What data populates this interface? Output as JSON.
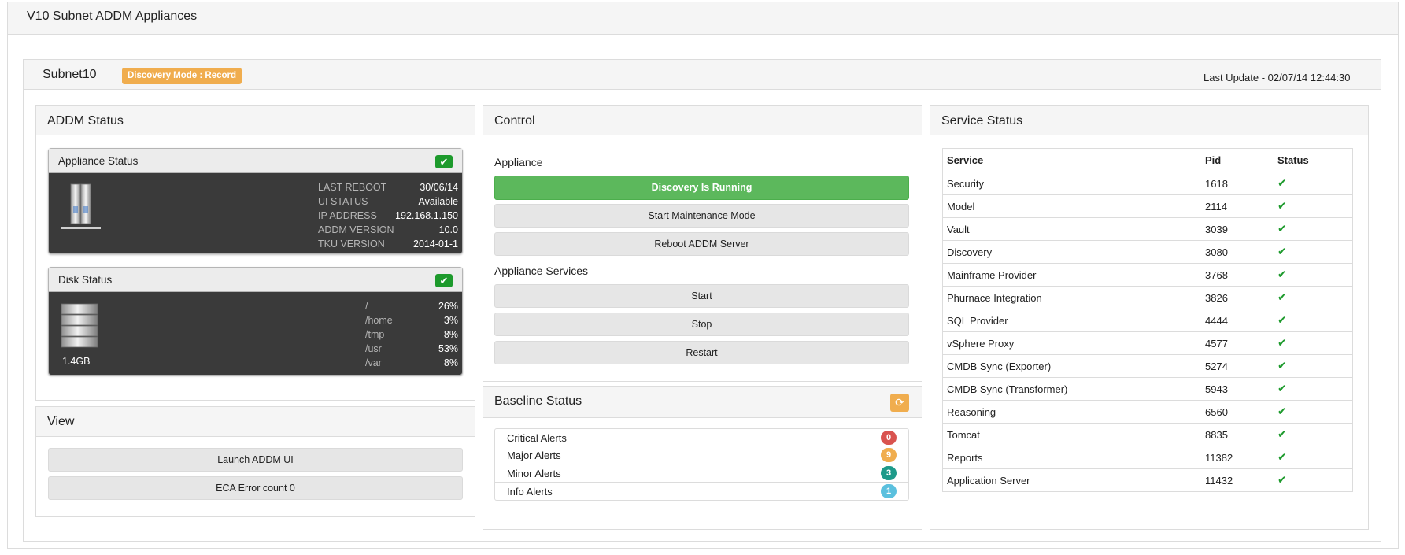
{
  "page": {
    "title": "V10 Subnet ADDM Appliances"
  },
  "subnet": {
    "name": "Subnet10",
    "mode_badge": "Discovery Mode : Record",
    "last_update": "Last Update - 02/07/14 12:44:30"
  },
  "addm_status": {
    "title": "ADDM Status",
    "appliance": {
      "title": "Appliance Status",
      "rows": [
        {
          "label": "LAST REBOOT",
          "value": "30/06/14"
        },
        {
          "label": "UI STATUS",
          "value": "Available"
        },
        {
          "label": "IP ADDRESS",
          "value": "192.168.1.150"
        },
        {
          "label": "ADDM VERSION",
          "value": "10.0"
        },
        {
          "label": "TKU VERSION",
          "value": "2014-01-1"
        }
      ],
      "icon": "server-icon",
      "status_icon": "check-icon"
    },
    "disk": {
      "title": "Disk Status",
      "size": "1.4GB",
      "rows": [
        {
          "label": "/",
          "value": "26%"
        },
        {
          "label": "/home",
          "value": "3%"
        },
        {
          "label": "/tmp",
          "value": "8%"
        },
        {
          "label": "/usr",
          "value": "53%"
        },
        {
          "label": "/var",
          "value": "8%"
        }
      ],
      "icon": "disk-stack-icon",
      "status_icon": "check-icon"
    }
  },
  "view": {
    "title": "View",
    "buttons": [
      "Launch ADDM UI",
      "ECA Error count 0"
    ]
  },
  "control": {
    "title": "Control",
    "appliance_label": "Appliance",
    "appliance_buttons": [
      "Discovery Is Running",
      "Start Maintenance Mode",
      "Reboot ADDM Server"
    ],
    "services_label": "Appliance Services",
    "service_buttons": [
      "Start",
      "Stop",
      "Restart"
    ]
  },
  "baseline": {
    "title": "Baseline Status",
    "refresh_icon": "refresh-icon",
    "alerts": [
      {
        "label": "Critical Alerts",
        "count": "0",
        "color": "#d9534f"
      },
      {
        "label": "Major Alerts",
        "count": "9",
        "color": "#f0ad4e"
      },
      {
        "label": "Minor Alerts",
        "count": "3",
        "color": "#1e9a8a"
      },
      {
        "label": "Info Alerts",
        "count": "1",
        "color": "#5bc0de"
      }
    ]
  },
  "service_status": {
    "title": "Service Status",
    "columns": [
      "Service",
      "Pid",
      "Status"
    ],
    "rows": [
      {
        "service": "Security",
        "pid": "1618",
        "status": "ok"
      },
      {
        "service": "Model",
        "pid": "2114",
        "status": "ok"
      },
      {
        "service": "Vault",
        "pid": "3039",
        "status": "ok"
      },
      {
        "service": "Discovery",
        "pid": "3080",
        "status": "ok"
      },
      {
        "service": "Mainframe Provider",
        "pid": "3768",
        "status": "ok"
      },
      {
        "service": "Phurnace Integration",
        "pid": "3826",
        "status": "ok"
      },
      {
        "service": "SQL Provider",
        "pid": "4444",
        "status": "ok"
      },
      {
        "service": "vSphere Proxy",
        "pid": "4577",
        "status": "ok"
      },
      {
        "service": "CMDB Sync (Exporter)",
        "pid": "5274",
        "status": "ok"
      },
      {
        "service": "CMDB Sync (Transformer)",
        "pid": "5943",
        "status": "ok"
      },
      {
        "service": "Reasoning",
        "pid": "6560",
        "status": "ok"
      },
      {
        "service": "Tomcat",
        "pid": "8835",
        "status": "ok"
      },
      {
        "service": "Reports",
        "pid": "11382",
        "status": "ok"
      },
      {
        "service": "Application Server",
        "pid": "11432",
        "status": "ok"
      }
    ]
  },
  "colors": {
    "success": "#5cb85c",
    "warning": "#f0ad4e",
    "check": "#1d9a2c"
  }
}
